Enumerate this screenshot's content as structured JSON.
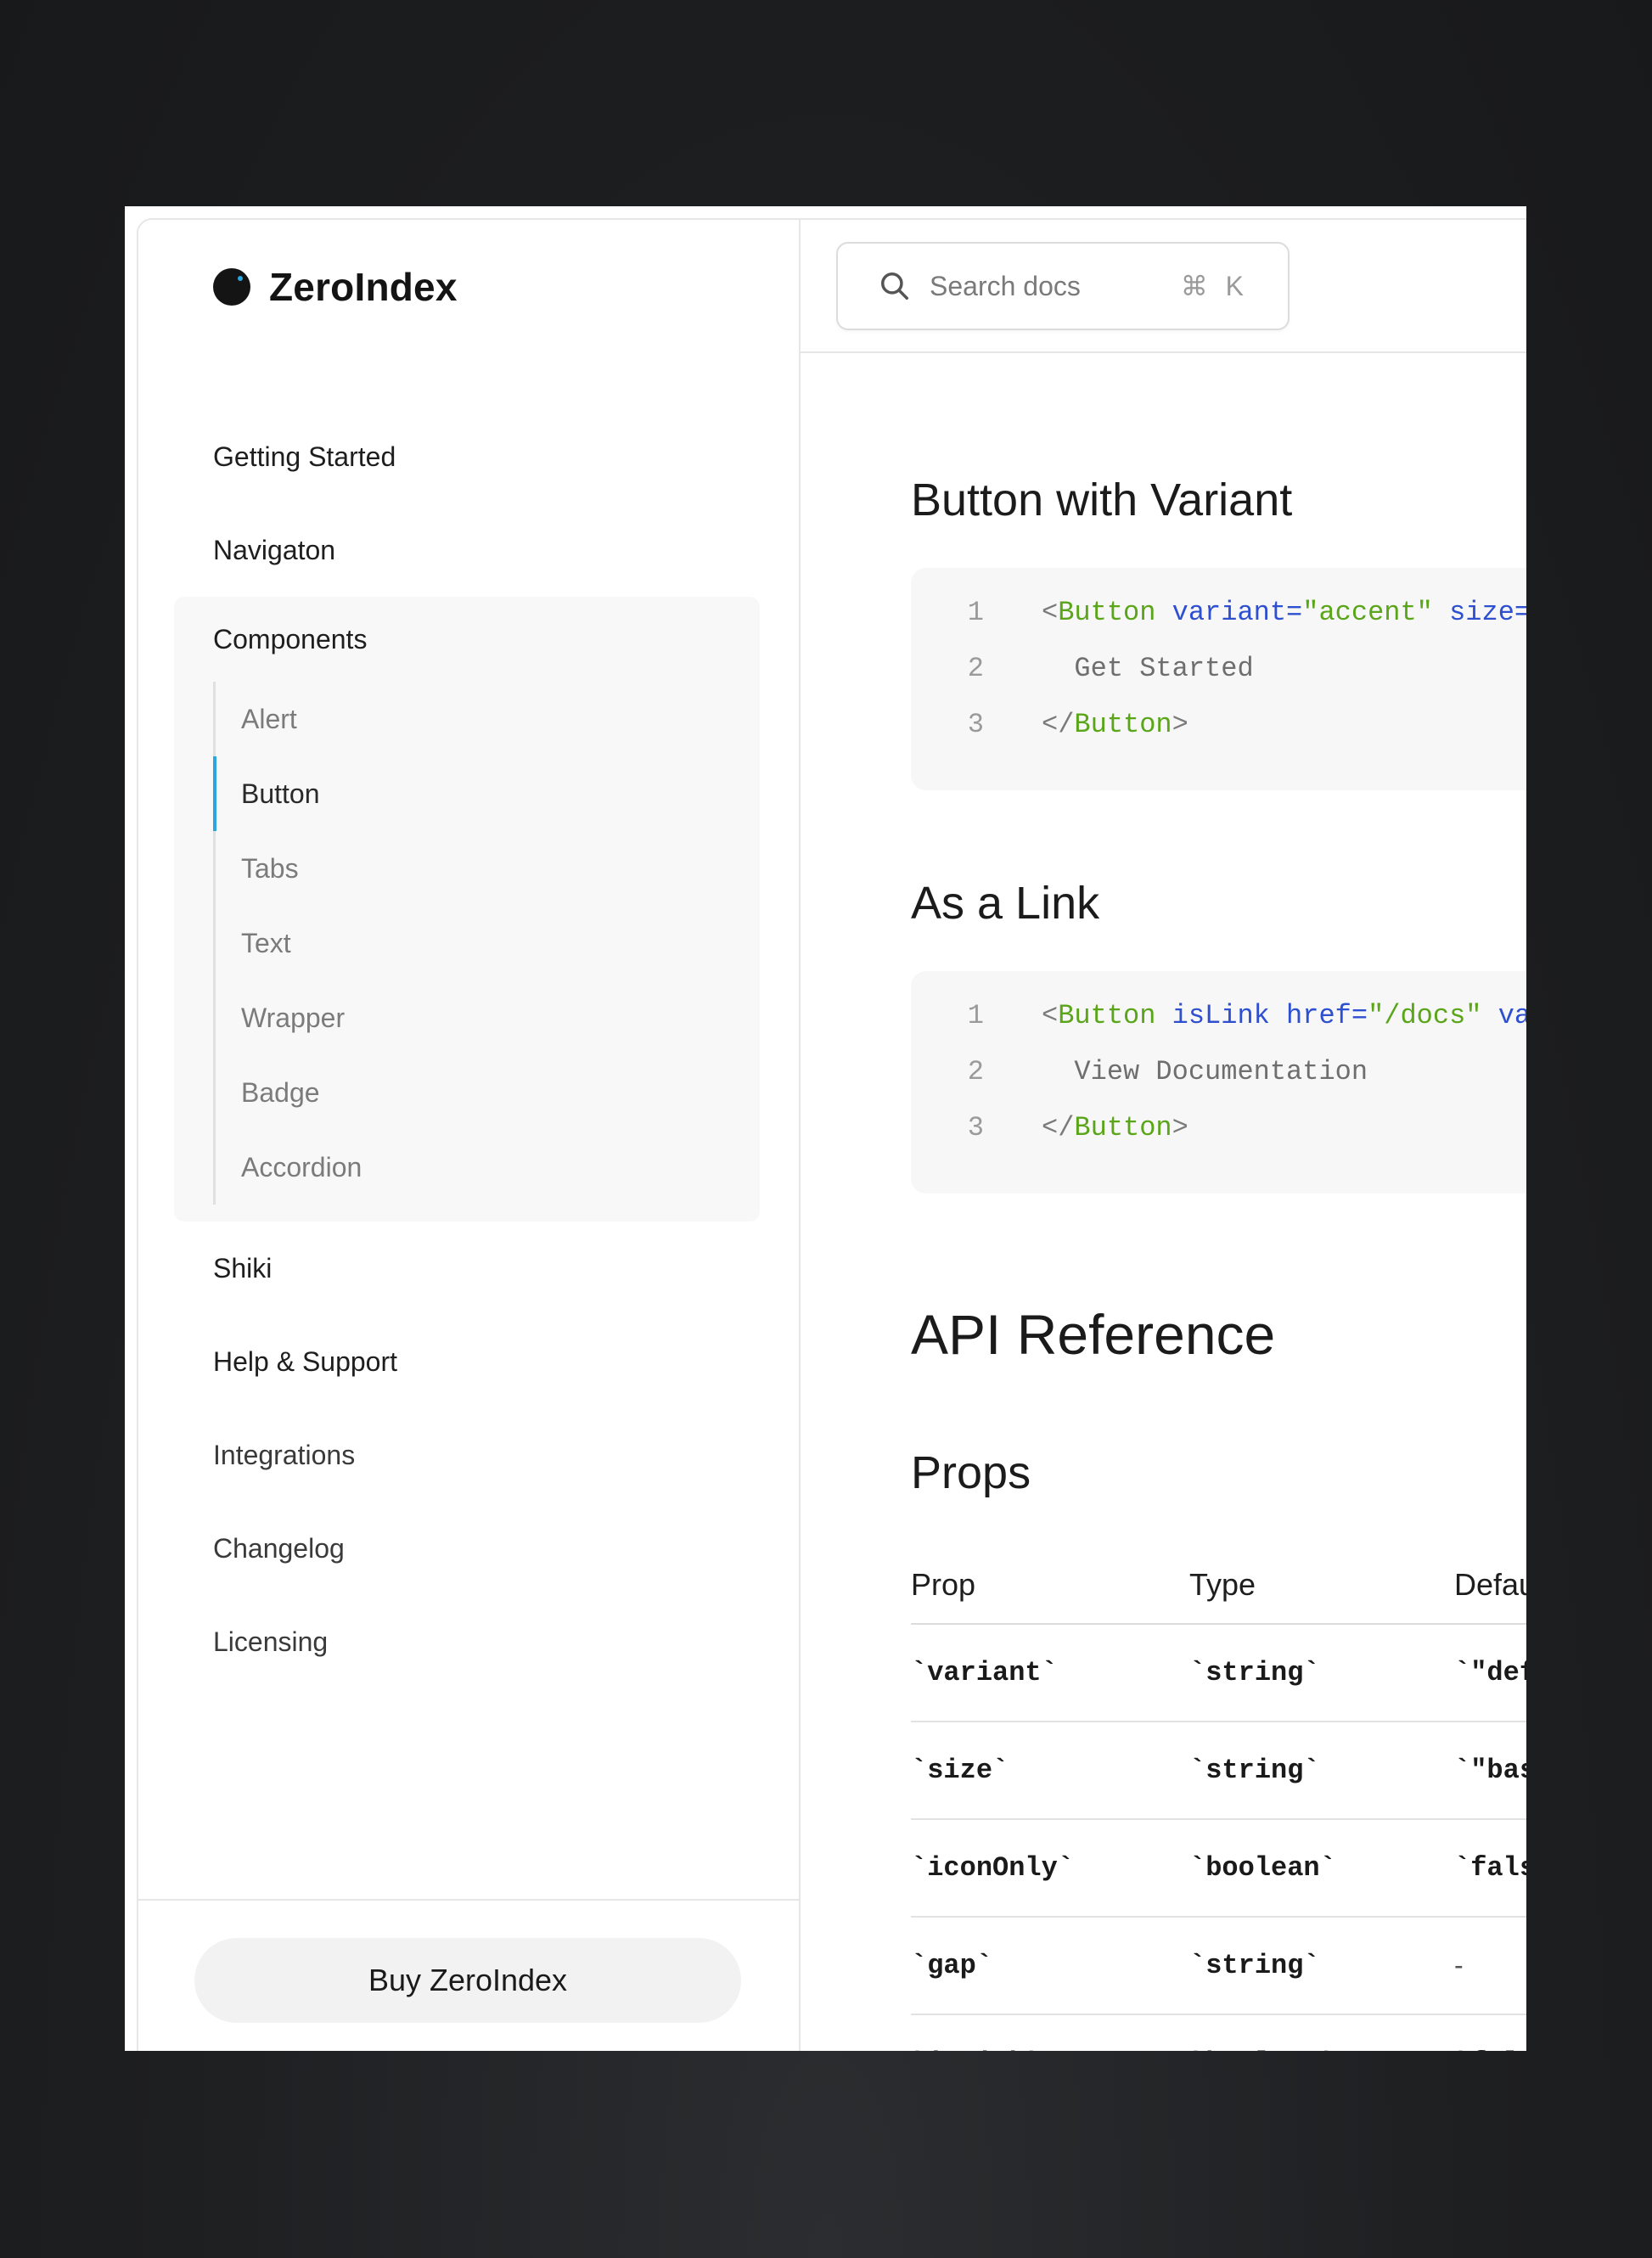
{
  "brand": {
    "name": "ZeroIndex"
  },
  "search": {
    "placeholder": "Search docs",
    "shortcut": "⌘ K"
  },
  "sidebar": {
    "items_top": [
      "Getting Started",
      "Navigaton"
    ],
    "group": {
      "label": "Components",
      "items": [
        "Alert",
        "Button",
        "Tabs",
        "Text",
        "Wrapper",
        "Badge",
        "Accordion"
      ],
      "active": "Button"
    },
    "items_bottom": [
      "Shiki",
      "Help & Support",
      "Integrations",
      "Changelog",
      "Licensing"
    ],
    "buy_label": "Buy ZeroIndex"
  },
  "main": {
    "section_variant_title": "Button with Variant",
    "variant_code": {
      "lines": [
        "1",
        "2",
        "3"
      ],
      "l1_lt": "<",
      "l1_tag": "Button",
      "l1_attr1": " variant=",
      "l1_val1": "\"accent\"",
      "l1_attr2": " size=",
      "l2_text": "  Get Started",
      "l3_lt": "</",
      "l3_tag": "Button",
      "l3_gt": ">"
    },
    "section_link_title": "As a Link",
    "link_code": {
      "lines": [
        "1",
        "2",
        "3"
      ],
      "l1_lt": "<",
      "l1_tag": "Button",
      "l1_attr1": " isLink",
      "l1_attr2": " href=",
      "l1_val2": "\"/docs\"",
      "l1_attr3": " va",
      "l2_text": "  View Documentation",
      "l3_lt": "</",
      "l3_tag": "Button",
      "l3_gt": ">"
    },
    "api_title": "API Reference",
    "props_title": "Props",
    "props_table": {
      "headers": [
        "Prop",
        "Type",
        "Default"
      ],
      "rows": [
        [
          "`variant`",
          "`string`",
          "`\"defau"
        ],
        [
          "`size`",
          "`string`",
          "`\"base\""
        ],
        [
          "`iconOnly`",
          "`boolean`",
          "`false"
        ],
        [
          "`gap`",
          "`string`",
          "-"
        ],
        [
          "`isLink`",
          "`boolean`",
          "`false"
        ]
      ]
    }
  },
  "colors": {
    "accent": "#2ca6e0",
    "code_tag": "#5aa519",
    "code_attr": "#2d4fd0"
  }
}
